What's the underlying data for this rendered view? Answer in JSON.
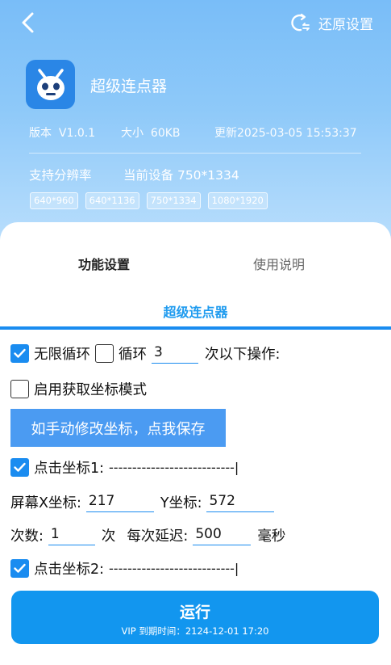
{
  "header": {
    "restore_label": "还原设置",
    "app_name": "超级连点器",
    "version_label": "版本",
    "version": "V1.0.1",
    "size_label": "大小",
    "size": "60KB",
    "updated_label": "更新",
    "updated": "2025-03-05 15:53:37",
    "resolution_title": "支持分辨率",
    "current_device_label": "当前设备",
    "current_device": "750*1334",
    "resolutions": [
      "640*960",
      "640*1136",
      "750*1334",
      "1080*1920"
    ]
  },
  "tabs": {
    "settings": "功能设置",
    "help": "使用说明"
  },
  "section_title": "超级连点器",
  "loop": {
    "infinite_label": "无限循环",
    "infinite_checked": true,
    "loop_label": "循环",
    "loop_checked": false,
    "loop_count": "3",
    "suffix": "次以下操作:"
  },
  "coord_mode": {
    "label": "启用获取坐标模式",
    "checked": false
  },
  "save_button": "如手动修改坐标，点我保存",
  "click1": {
    "label": "点击坐标1:",
    "line": "---------------------------|",
    "checked": true,
    "x_label": "屏幕X坐标:",
    "x": "217",
    "y_label": "Y坐标:",
    "y": "572",
    "count_label": "次数:",
    "count": "1",
    "count_unit": "次",
    "delay_label": "每次延迟:",
    "delay": "500",
    "delay_unit": "毫秒"
  },
  "click2": {
    "label": "点击坐标2:",
    "line": "---------------------------|",
    "checked": true
  },
  "run": {
    "label": "运行",
    "vip": "VIP 到期时间：2124-12-01 17:20"
  }
}
